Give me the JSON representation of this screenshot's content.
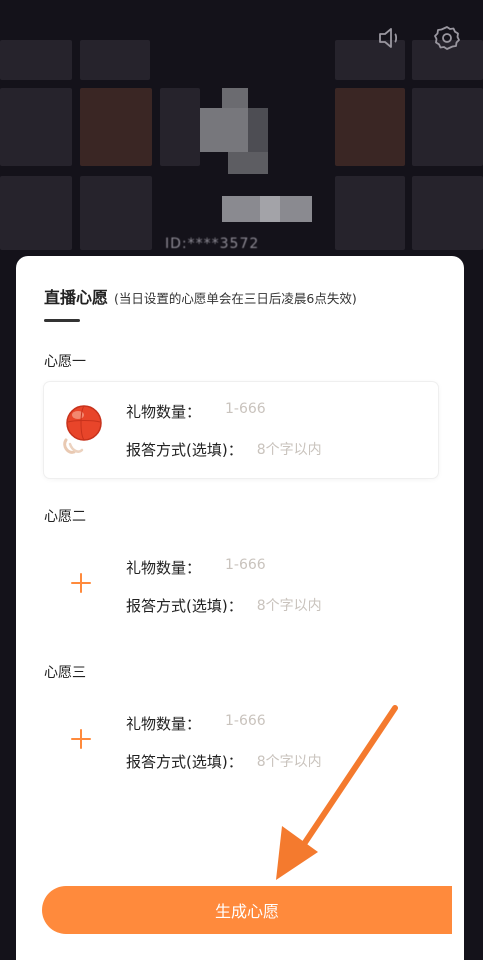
{
  "header": {
    "id_text": "ID:****3572",
    "icons": [
      "speaker-icon",
      "settings-icon"
    ]
  },
  "sheet": {
    "title": "直播心愿",
    "subtitle": "(当日设置的心愿单会在三日后凌晨6点失效)",
    "wishes": [
      {
        "label": "心愿一",
        "gift_label": "礼物数量：",
        "gift_placeholder": "1-666",
        "reply_label": "报答方式(选填)：",
        "reply_placeholder": "8个字以内",
        "icon": "gift-icon"
      },
      {
        "label": "心愿二",
        "gift_label": "礼物数量：",
        "gift_placeholder": "1-666",
        "reply_label": "报答方式(选填)：",
        "reply_placeholder": "8个字以内",
        "icon": "plus-icon"
      },
      {
        "label": "心愿三",
        "gift_label": "礼物数量：",
        "gift_placeholder": "1-666",
        "reply_label": "报答方式(选填)：",
        "reply_placeholder": "8个字以内",
        "icon": "plus-icon"
      }
    ],
    "generate_button": "生成心愿"
  },
  "colors": {
    "accent": "#ff8a3c",
    "placeholder": "#c9c3bd",
    "background": "#14121a"
  }
}
